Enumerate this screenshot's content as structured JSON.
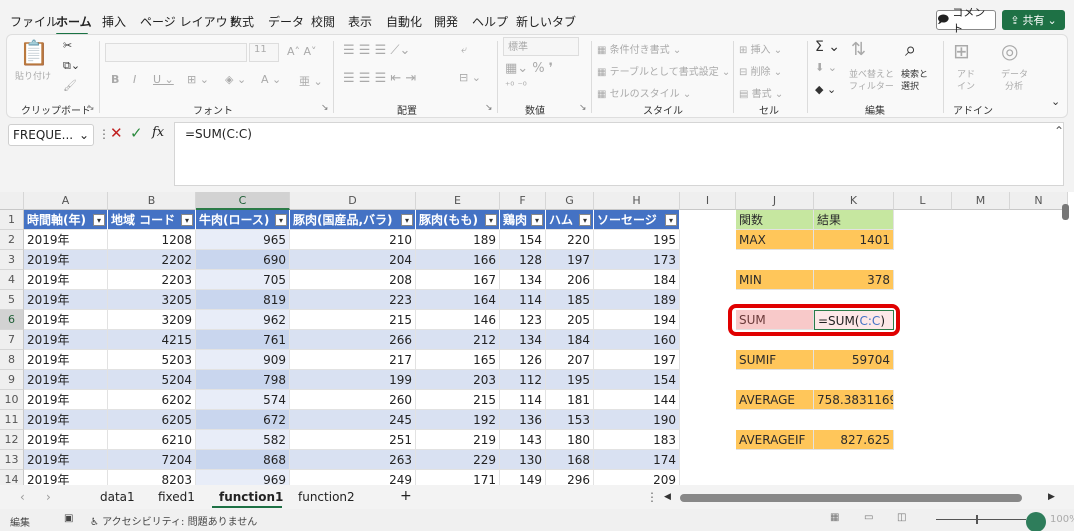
{
  "menu": {
    "tabs": [
      "ファイル",
      "ホーム",
      "挿入",
      "ページ レイアウト",
      "数式",
      "データ",
      "校閲",
      "表示",
      "自動化",
      "開発",
      "ヘルプ",
      "新しいタブ"
    ],
    "comment_label": "コメント",
    "share_label": "共有"
  },
  "ribbon": {
    "clipboard": {
      "label": "クリップボード",
      "paste": "貼り付け"
    },
    "font": {
      "label": "フォント",
      "size": "11"
    },
    "alignment": {
      "label": "配置"
    },
    "number": {
      "label": "数値",
      "format": "標準"
    },
    "styles": {
      "label": "スタイル",
      "conditional": "条件付き書式",
      "as_table": "テーブルとして書式設定",
      "cell_styles": "セルのスタイル"
    },
    "cells": {
      "label": "セル",
      "insert": "挿入",
      "delete": "削除",
      "format": "書式"
    },
    "editing": {
      "label": "編集",
      "sort": "並べ替えと",
      "filter": "フィルター",
      "find": "検索と",
      "select": "選択"
    },
    "addins": {
      "label": "アドイン",
      "addin": "アド",
      "addin2": "イン",
      "analyze": "データ",
      "analyze2": "分析"
    }
  },
  "formula_bar": {
    "name_box": "FREQUE...",
    "formula": "=SUM(C:C)"
  },
  "columns": [
    "A",
    "B",
    "C",
    "D",
    "E",
    "F",
    "G",
    "H",
    "I",
    "J",
    "K",
    "L",
    "M",
    "N"
  ],
  "table_headers": [
    "時間軸(年)",
    "地域 コード",
    "牛肉(ロース)",
    "豚肉(国産品,バラ)",
    "豚肉(もも)",
    "鶏肉",
    "ハム",
    "ソーセージ"
  ],
  "rows": [
    {
      "n": "2",
      "a": "2019年",
      "b": "1208",
      "c": "965",
      "d": "210",
      "e": "189",
      "f": "154",
      "g": "220",
      "h": "195"
    },
    {
      "n": "3",
      "a": "2019年",
      "b": "2202",
      "c": "690",
      "d": "204",
      "e": "166",
      "f": "128",
      "g": "197",
      "h": "173"
    },
    {
      "n": "4",
      "a": "2019年",
      "b": "2203",
      "c": "705",
      "d": "208",
      "e": "167",
      "f": "134",
      "g": "206",
      "h": "184"
    },
    {
      "n": "5",
      "a": "2019年",
      "b": "3205",
      "c": "819",
      "d": "223",
      "e": "164",
      "f": "114",
      "g": "185",
      "h": "189"
    },
    {
      "n": "6",
      "a": "2019年",
      "b": "3209",
      "c": "962",
      "d": "215",
      "e": "146",
      "f": "123",
      "g": "205",
      "h": "194"
    },
    {
      "n": "7",
      "a": "2019年",
      "b": "4215",
      "c": "761",
      "d": "266",
      "e": "212",
      "f": "134",
      "g": "184",
      "h": "160"
    },
    {
      "n": "8",
      "a": "2019年",
      "b": "5203",
      "c": "909",
      "d": "217",
      "e": "165",
      "f": "126",
      "g": "207",
      "h": "197"
    },
    {
      "n": "9",
      "a": "2019年",
      "b": "5204",
      "c": "798",
      "d": "199",
      "e": "203",
      "f": "112",
      "g": "195",
      "h": "154"
    },
    {
      "n": "10",
      "a": "2019年",
      "b": "6202",
      "c": "574",
      "d": "260",
      "e": "215",
      "f": "114",
      "g": "181",
      "h": "144"
    },
    {
      "n": "11",
      "a": "2019年",
      "b": "6205",
      "c": "672",
      "d": "245",
      "e": "192",
      "f": "136",
      "g": "153",
      "h": "190"
    },
    {
      "n": "12",
      "a": "2019年",
      "b": "6210",
      "c": "582",
      "d": "251",
      "e": "219",
      "f": "143",
      "g": "180",
      "h": "183"
    },
    {
      "n": "13",
      "a": "2019年",
      "b": "7204",
      "c": "868",
      "d": "263",
      "e": "229",
      "f": "130",
      "g": "168",
      "h": "174"
    },
    {
      "n": "14",
      "a": "2019年",
      "b": "8203",
      "c": "969",
      "d": "249",
      "e": "171",
      "f": "149",
      "g": "296",
      "h": "209"
    }
  ],
  "side": {
    "header_func": "関数",
    "header_result": "結果",
    "max_label": "MAX",
    "max_value": "1401",
    "min_label": "MIN",
    "min_value": "378",
    "sum_label": "SUM",
    "sum_prefix": "=SUM(",
    "sum_ref": "C:C",
    "sum_suffix": ")",
    "sumif_label": "SUMIF",
    "sumif_value": "59704",
    "avg_label": "AVERAGE",
    "avg_value": "758.3831169",
    "avgif_label": "AVERAGEIF",
    "avgif_value": "827.625"
  },
  "sheets": [
    "data1",
    "fixed1",
    "function1",
    "function2"
  ],
  "status": {
    "mode": "編集",
    "accessibility": "アクセシビリティ: 問題ありません",
    "zoom": "100%"
  },
  "colors": {
    "accent": "#1e7145",
    "table_header": "#4472c4",
    "band": "#d9e1f2",
    "highlight": "#e00000"
  }
}
